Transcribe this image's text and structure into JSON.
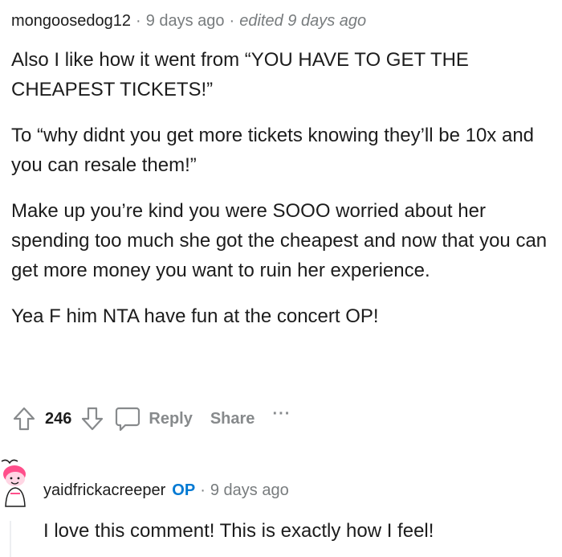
{
  "comment": {
    "username": "mongoosedog12",
    "separator": "·",
    "timestamp": "9 days ago",
    "edited": "edited 9 days ago",
    "paragraphs": [
      "Also I like how it went from “YOU HAVE TO GET THE CHEAPEST TICKETS!”",
      "To “why didnt you get more tickets knowing they’ll be 10x and you can resale them!”",
      "Make up you’re kind you were SOOO worried about her spending too much she got the cheapest and now that you can get more money you want to ruin her experience.",
      "Yea F him NTA have fun at the concert OP!"
    ],
    "vote_count": "246",
    "reply_label": "Reply",
    "share_label": "Share",
    "more_label": "···"
  },
  "reply": {
    "username": "yaidfrickacreeper",
    "op_badge": "OP",
    "separator": "·",
    "timestamp": "9 days ago",
    "text": "I love this comment! This is exactly how I feel!"
  },
  "icons": {
    "upvote": "upvote-arrow-icon",
    "downvote": "downvote-arrow-icon",
    "reply": "comment-bubble-icon",
    "avatar": "snoo-avatar-icon"
  },
  "colors": {
    "text": "#1c1c1c",
    "meta": "#787c7e",
    "action": "#878a8c",
    "op_badge": "#0079d3",
    "avatar_pink": "#ff4f8b"
  }
}
